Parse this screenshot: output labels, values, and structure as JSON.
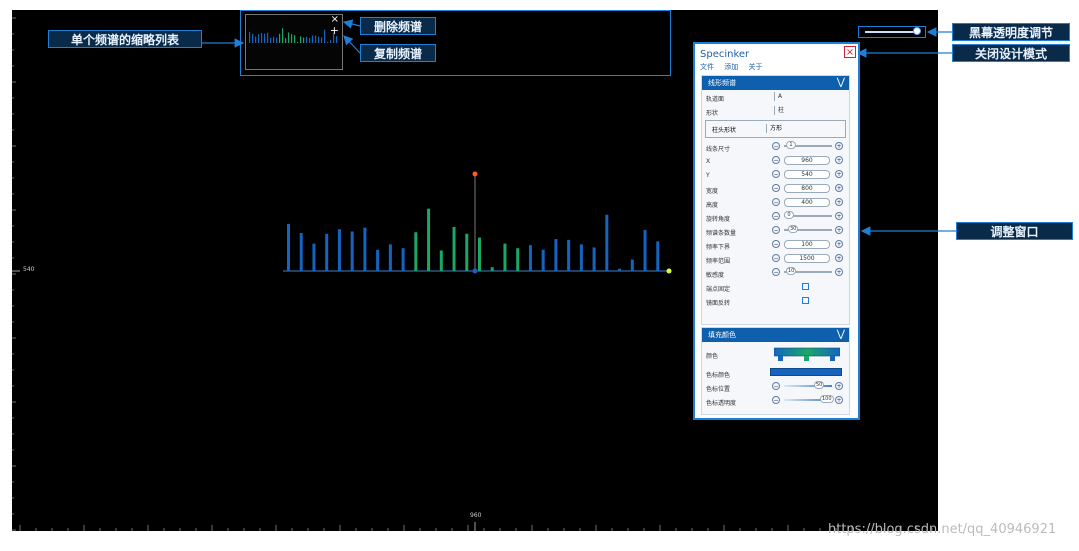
{
  "callouts": {
    "thumbnail_list": "单个频谱的缩略列表",
    "delete_spectrum": "删除频谱",
    "copy_spectrum": "复制频谱",
    "black_opacity": "黑幕透明度调节",
    "close_design": "关闭设计模式",
    "resize_window": "调整窗口"
  },
  "axis": {
    "y_label": "540",
    "x_label": "960"
  },
  "thumbnail": {
    "delete_icon": "×",
    "copy_icon": "+"
  },
  "spectrum": {
    "bars": [
      {
        "v": 0.62,
        "c": "blue"
      },
      {
        "v": 0.5,
        "c": "blue"
      },
      {
        "v": 0.36,
        "c": "blue"
      },
      {
        "v": 0.49,
        "c": "blue"
      },
      {
        "v": 0.55,
        "c": "blue"
      },
      {
        "v": 0.52,
        "c": "blue"
      },
      {
        "v": 0.57,
        "c": "blue"
      },
      {
        "v": 0.28,
        "c": "blue"
      },
      {
        "v": 0.35,
        "c": "blue"
      },
      {
        "v": 0.3,
        "c": "blue"
      },
      {
        "v": 0.51,
        "c": "green"
      },
      {
        "v": 0.82,
        "c": "green"
      },
      {
        "v": 0.27,
        "c": "green"
      },
      {
        "v": 0.58,
        "c": "green"
      },
      {
        "v": 0.49,
        "c": "green"
      },
      {
        "v": 0.44,
        "c": "green"
      },
      {
        "v": 0.05,
        "c": "green"
      },
      {
        "v": 0.36,
        "c": "green"
      },
      {
        "v": 0.3,
        "c": "green"
      },
      {
        "v": 0.34,
        "c": "blue"
      },
      {
        "v": 0.28,
        "c": "blue"
      },
      {
        "v": 0.42,
        "c": "blue"
      },
      {
        "v": 0.41,
        "c": "blue"
      },
      {
        "v": 0.35,
        "c": "blue"
      },
      {
        "v": 0.31,
        "c": "blue"
      },
      {
        "v": 0.74,
        "c": "blue"
      },
      {
        "v": 0.03,
        "c": "blue"
      },
      {
        "v": 0.15,
        "c": "blue"
      },
      {
        "v": 0.54,
        "c": "blue"
      },
      {
        "v": 0.39,
        "c": "blue"
      }
    ],
    "colors": {
      "blue": "#1565c0",
      "green": "#1aa866",
      "handle_top": "#ff5a2a",
      "handle_end": "#d8ff2a"
    }
  },
  "panel": {
    "title": "Specinker",
    "close_icon": "×",
    "menu": [
      "文件",
      "添加",
      "关于"
    ],
    "section1": {
      "title": "线形频谱",
      "chevron": "⋁",
      "track": {
        "label": "轨道面",
        "value": "A"
      },
      "shape": {
        "label": "形状",
        "value": "柱"
      },
      "column_shape": {
        "label": "柱头形状",
        "value": "方形"
      },
      "line_size": {
        "label": "线条尺寸",
        "value": "1"
      },
      "x": {
        "label": "X",
        "value": "960"
      },
      "y": {
        "label": "Y",
        "value": "540"
      },
      "width": {
        "label": "宽度",
        "value": "800"
      },
      "height": {
        "label": "高度",
        "value": "400"
      },
      "rotation": {
        "label": "旋转角度",
        "value": "0"
      },
      "band_count": {
        "label": "频谱条数量",
        "value": "30"
      },
      "freq_lower": {
        "label": "频率下界",
        "value": "100"
      },
      "freq_range": {
        "label": "频率范围",
        "value": "1500"
      },
      "sensitivity": {
        "label": "敏感度",
        "value": "10"
      },
      "endpoint_fixed": {
        "label": "端点固定"
      },
      "mirror_flip": {
        "label": "镜面反转"
      }
    },
    "section2": {
      "title": "填充颜色",
      "chevron": "⋁",
      "color": {
        "label": "颜色"
      },
      "color_stop_color": {
        "label": "色标颜色"
      },
      "color_stop_pos": {
        "label": "色标位置",
        "value": "50"
      },
      "color_stop_opacity": {
        "label": "色标透明度",
        "value": "100"
      },
      "gradient": [
        "#1565c0",
        "#1aa866",
        "#1565c0"
      ],
      "stop_color": "#1565c0"
    }
  },
  "watermark": "https://blog.csdn.net/qq_40946921"
}
